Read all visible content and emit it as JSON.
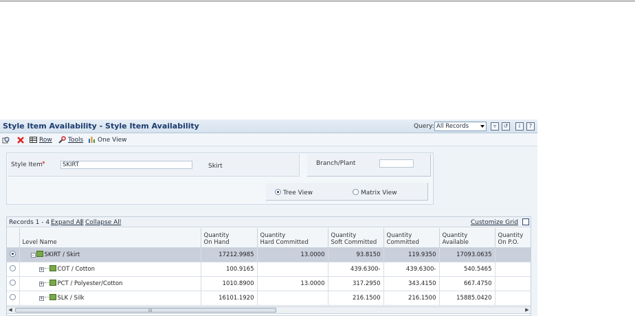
{
  "window": {
    "title": "Style Item Availability - Style Item Availability",
    "query_label": "Query:",
    "query_value": "All Records",
    "icons": [
      "personalize-icon",
      "export-icon",
      "info-icon",
      "help-icon"
    ]
  },
  "toolbar": {
    "row_label": "Row",
    "tools_label": "Tools",
    "one_view_label": "One View"
  },
  "form": {
    "style_item_label": "Style Item",
    "required_marker": "*",
    "style_item_value": "SKIRT",
    "style_item_desc": "Skirt",
    "branch_label": "Branch/Plant",
    "branch_value": "",
    "tree_view_label": "Tree View",
    "matrix_view_label": "Matrix View",
    "selected_view": "tree"
  },
  "grid": {
    "records_label": "Records 1 - 4",
    "expand_all": "Expand All",
    "collapse_all": "Collapse All",
    "separator": "|",
    "customize": "Customize Grid",
    "columns": [
      {
        "line1": "",
        "line2": "Level Name"
      },
      {
        "line1": "Quantity",
        "line2": "On Hand"
      },
      {
        "line1": "Quantity",
        "line2": "Hard Committed"
      },
      {
        "line1": "Quantity",
        "line2": "Soft Committed"
      },
      {
        "line1": "Quantity",
        "line2": "Committed"
      },
      {
        "line1": "Quantity",
        "line2": "Available"
      },
      {
        "line1": "Quantity",
        "line2": "On P.O."
      }
    ],
    "rows": [
      {
        "level": "SKIRT / Skirt",
        "on_hand": "17212.9985",
        "hard": "13.0000",
        "soft": "93.8150",
        "committed": "119.9350",
        "available": "17093.0635",
        "on_po": ""
      },
      {
        "level": "COT / Cotton",
        "on_hand": "100.9165",
        "hard": "",
        "soft": "439.6300-",
        "committed": "439.6300-",
        "available": "540.5465",
        "on_po": ""
      },
      {
        "level": "PCT / Polyester/Cotton",
        "on_hand": "1010.8900",
        "hard": "13.0000",
        "soft": "317.2950",
        "committed": "343.4150",
        "available": "667.4750",
        "on_po": ""
      },
      {
        "level": "SLK / Silk",
        "on_hand": "16101.1920",
        "hard": "",
        "soft": "216.1500",
        "committed": "216.1500",
        "available": "15885.0420",
        "on_po": ""
      }
    ]
  },
  "scrollbar": {
    "grip": "III"
  }
}
